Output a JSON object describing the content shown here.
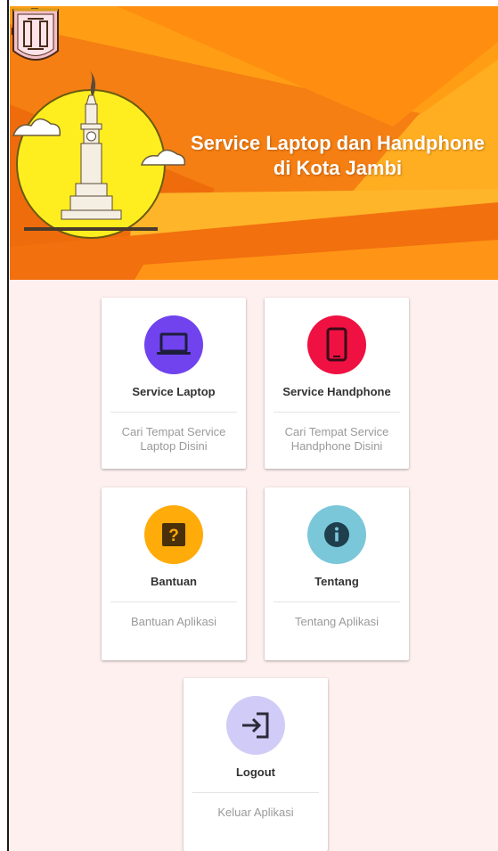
{
  "header": {
    "title_line1": "Service Laptop dan Handphone",
    "title_line2": "di Kota Jambi",
    "app_logo_icon": "gear-tools-icon",
    "school_logo_icon": "school-emblem-icon"
  },
  "menu": {
    "service_laptop": {
      "title": "Service Laptop",
      "desc_line1": "Cari Tempat Service",
      "desc_line2": "Laptop Disini",
      "icon": "laptop-icon",
      "color": "#7043ef"
    },
    "service_handphone": {
      "title": "Service Handphone",
      "desc_line1": "Cari Tempat Service",
      "desc_line2": "Handphone Disini",
      "icon": "smartphone-icon",
      "color": "#ef1141"
    },
    "bantuan": {
      "title": "Bantuan",
      "desc_line1": "Bantuan Aplikasi",
      "icon": "help-icon",
      "color": "#ffab0a"
    },
    "tentang": {
      "title": "Tentang",
      "desc_line1": "Tentang Aplikasi",
      "icon": "info-icon",
      "color": "#7ac7d9"
    },
    "logout": {
      "title": "Logout",
      "desc_line1": "Keluar Aplikasi",
      "icon": "logout-icon",
      "color": "#d1ccf7"
    }
  },
  "colors": {
    "background": "#fdf0ef",
    "banner_orange": "#ffac1c",
    "banner_dark_orange": "#f26b0f"
  }
}
